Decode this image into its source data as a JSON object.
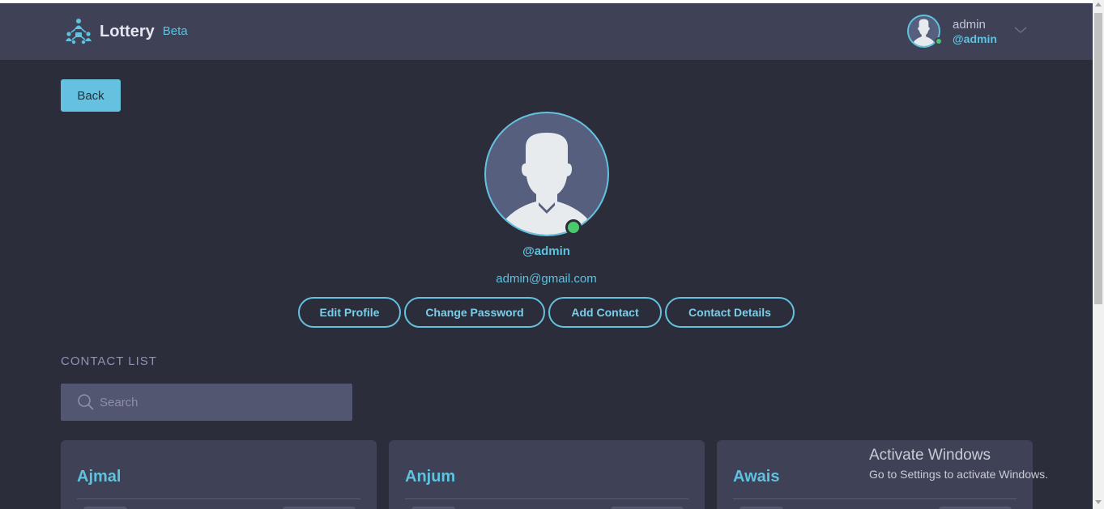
{
  "navbar": {
    "brand_name": "Lottery",
    "brand_badge": "Beta",
    "user_name": "admin",
    "user_handle": "@admin"
  },
  "back_label": "Back",
  "profile": {
    "handle": "@admin",
    "email": "admin@gmail.com"
  },
  "actions": {
    "edit_profile": "Edit Profile",
    "change_password": "Change Password",
    "add_contact": "Add Contact",
    "contact_details": "Contact Details"
  },
  "contacts": {
    "heading": "CONTACT LIST",
    "search_placeholder": "Search",
    "items": [
      {
        "name": "Ajmal"
      },
      {
        "name": "Anjum"
      },
      {
        "name": "Awais"
      }
    ]
  },
  "watermark": {
    "title": "Activate Windows",
    "subtitle": "Go to Settings to activate Windows."
  },
  "colors": {
    "accent": "#64c2e0",
    "navbar_bg": "#3f4157",
    "page_bg": "#2c2d3a",
    "online": "#49c96b"
  },
  "icons": {
    "brand": "people-network-icon",
    "chevron": "chevron-down-icon",
    "search": "search-icon",
    "avatar": "user-silhouette-icon"
  }
}
